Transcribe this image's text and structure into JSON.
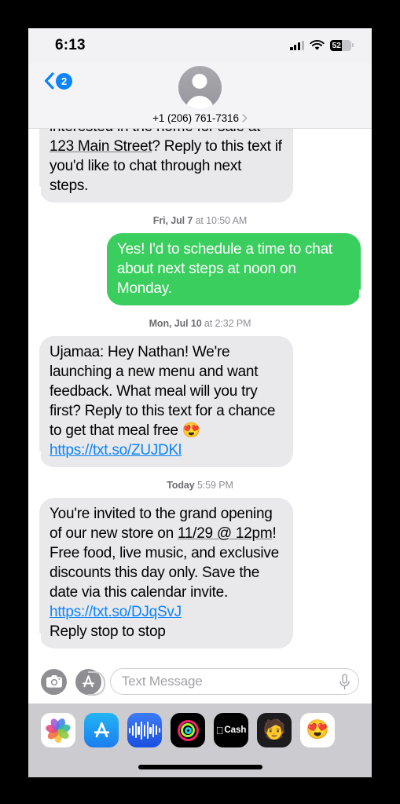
{
  "status_bar": {
    "time": "6:13",
    "cellular_icon": "cellular-signal-icon",
    "wifi_icon": "wifi-icon",
    "battery_percent": "52",
    "battery_icon": "battery-icon"
  },
  "nav": {
    "back_icon": "chevron-left-icon",
    "unread_badge": "2",
    "avatar_icon": "contact-avatar-placeholder",
    "contact_name": "+1 (206) 761-7316",
    "detail_chevron_icon": "chevron-right-icon"
  },
  "conversation": {
    "messages": [
      {
        "id": "msg-realtor",
        "side": "in",
        "clipped": true,
        "parts": [
          {
            "type": "text",
            "value": "interested in the home for sale at "
          },
          {
            "type": "detected",
            "value": "123 Main Street"
          },
          {
            "type": "text",
            "value": "? Reply to this text if you'd like to chat through next steps."
          }
        ]
      },
      {
        "id": "msg-reply-schedule",
        "side": "out",
        "parts": [
          {
            "type": "text",
            "value": "Yes! I'd to schedule a time to chat about next steps at noon on Monday."
          }
        ]
      },
      {
        "id": "msg-ujamaa",
        "side": "in",
        "parts": [
          {
            "type": "text",
            "value": "Ujamaa: Hey Nathan! We're launching a new menu and want feedback. What meal will you try first? Reply to this text for a chance to get that meal free 😍\n"
          },
          {
            "type": "link",
            "value": "https://txt.so/ZUJDKl"
          }
        ]
      },
      {
        "id": "msg-grand-opening",
        "side": "in",
        "parts": [
          {
            "type": "text",
            "value": "You're invited to the grand opening of our new store on "
          },
          {
            "type": "detected",
            "value": "11/29 @ 12pm"
          },
          {
            "type": "text",
            "value": "! Free food, live music, and exclusive discounts this day only. Save the date via this calendar invite. "
          },
          {
            "type": "link",
            "value": "https://txt.so/DJqSvJ"
          },
          {
            "type": "text",
            "value": "\nReply stop to stop"
          }
        ]
      }
    ],
    "timestamps": [
      {
        "id": "ts-jul7",
        "bold": "Fri, Jul 7",
        "rest": " at 10:50 AM"
      },
      {
        "id": "ts-jul10",
        "bold": "Mon, Jul 10",
        "rest": " at 2:32 PM"
      },
      {
        "id": "ts-today",
        "bold": "Today",
        "rest": " 5:59 PM"
      }
    ]
  },
  "input_bar": {
    "camera_icon": "camera-icon",
    "apps_icon": "app-store-icon",
    "placeholder": "Text Message",
    "mic_icon": "microphone-icon"
  },
  "app_drawer": {
    "items": [
      {
        "id": "app-photos",
        "icon": "photos-app-icon",
        "label": ""
      },
      {
        "id": "app-store",
        "icon": "app-store-app-icon",
        "label": ""
      },
      {
        "id": "app-music",
        "icon": "music-app-icon",
        "label": ""
      },
      {
        "id": "app-fitness",
        "icon": "fitness-app-icon",
        "label": ""
      },
      {
        "id": "app-cash",
        "icon": "apple-cash-icon",
        "label": "Cash"
      },
      {
        "id": "app-memoji",
        "icon": "memoji-icon",
        "label": "🧑"
      },
      {
        "id": "app-stickers",
        "icon": "memoji-stickers-icon",
        "label": "😍"
      }
    ]
  },
  "home_indicator": {
    "icon": "home-indicator-bar"
  },
  "colors": {
    "accent_blue": "#0b84fe",
    "sms_green": "#3ace5e",
    "incoming_gray": "#e9e9eb",
    "link_blue": "#0b84fe",
    "drawer_gray": "#cbcbd0"
  }
}
